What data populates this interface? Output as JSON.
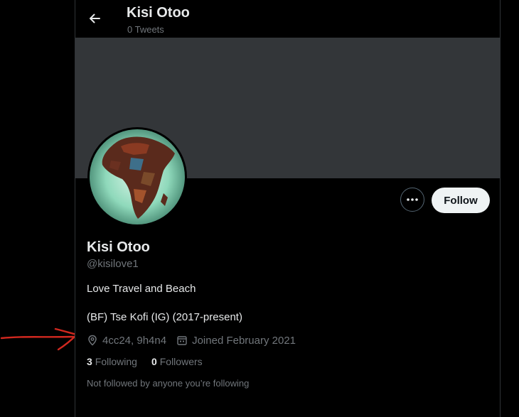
{
  "header": {
    "title": "Kisi Otoo",
    "subtitle": "0 Tweets"
  },
  "profile": {
    "name": "Kisi Otoo",
    "handle": "@kisilove1",
    "bio_line1": "Love Travel and Beach",
    "bio_line2": "(BF) Tse Kofi (IG) (2017-present)",
    "location": "4cc24, 9h4n4",
    "joined": "Joined February 2021",
    "following_count": "3",
    "following_label": "Following",
    "followers_count": "0",
    "followers_label": "Followers",
    "followed_note": "Not followed by anyone you’re following"
  },
  "actions": {
    "follow_label": "Follow"
  },
  "colors": {
    "background": "#000000",
    "banner": "#333639",
    "muted_text": "#71767b",
    "annotation_arrow": "#d1281f"
  },
  "icons": {
    "back": "arrow-left-icon",
    "more": "more-dots-icon",
    "location": "location-pin-icon",
    "calendar": "calendar-icon"
  }
}
